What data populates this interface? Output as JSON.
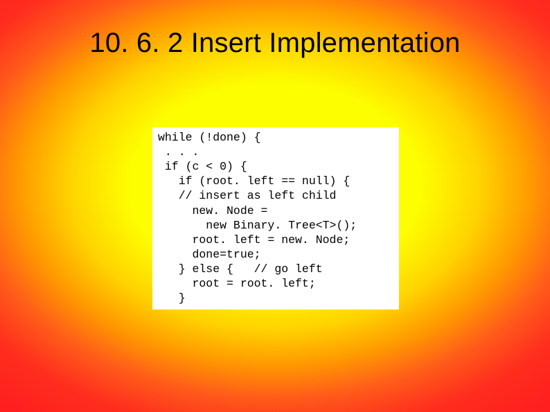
{
  "slide": {
    "title": "10. 6. 2 Insert Implementation",
    "code": "while (!done) {\n . . .\n if (c < 0) {\n   if (root. left == null) {\n   // insert as left child\n     new. Node =\n       new Binary. Tree<T>();\n     root. left = new. Node;\n     done=true;\n   } else {   // go left\n     root = root. left;\n   }"
  }
}
